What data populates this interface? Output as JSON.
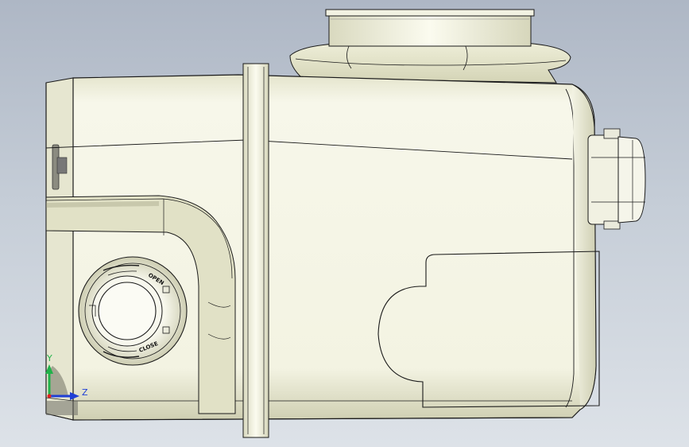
{
  "model": {
    "dial_labels": {
      "open": "OPEN",
      "close": "CLOSE"
    }
  },
  "triad": {
    "y_label": "Y",
    "z_label": "Z",
    "colors": {
      "y_axis": "#21b24a",
      "z_axis": "#1f3fd6",
      "x_axis": "#e02020"
    }
  },
  "colors": {
    "body_fill": "#f3f3e3",
    "shade": "#d8d8bc",
    "edge": "#1a1a1a"
  }
}
